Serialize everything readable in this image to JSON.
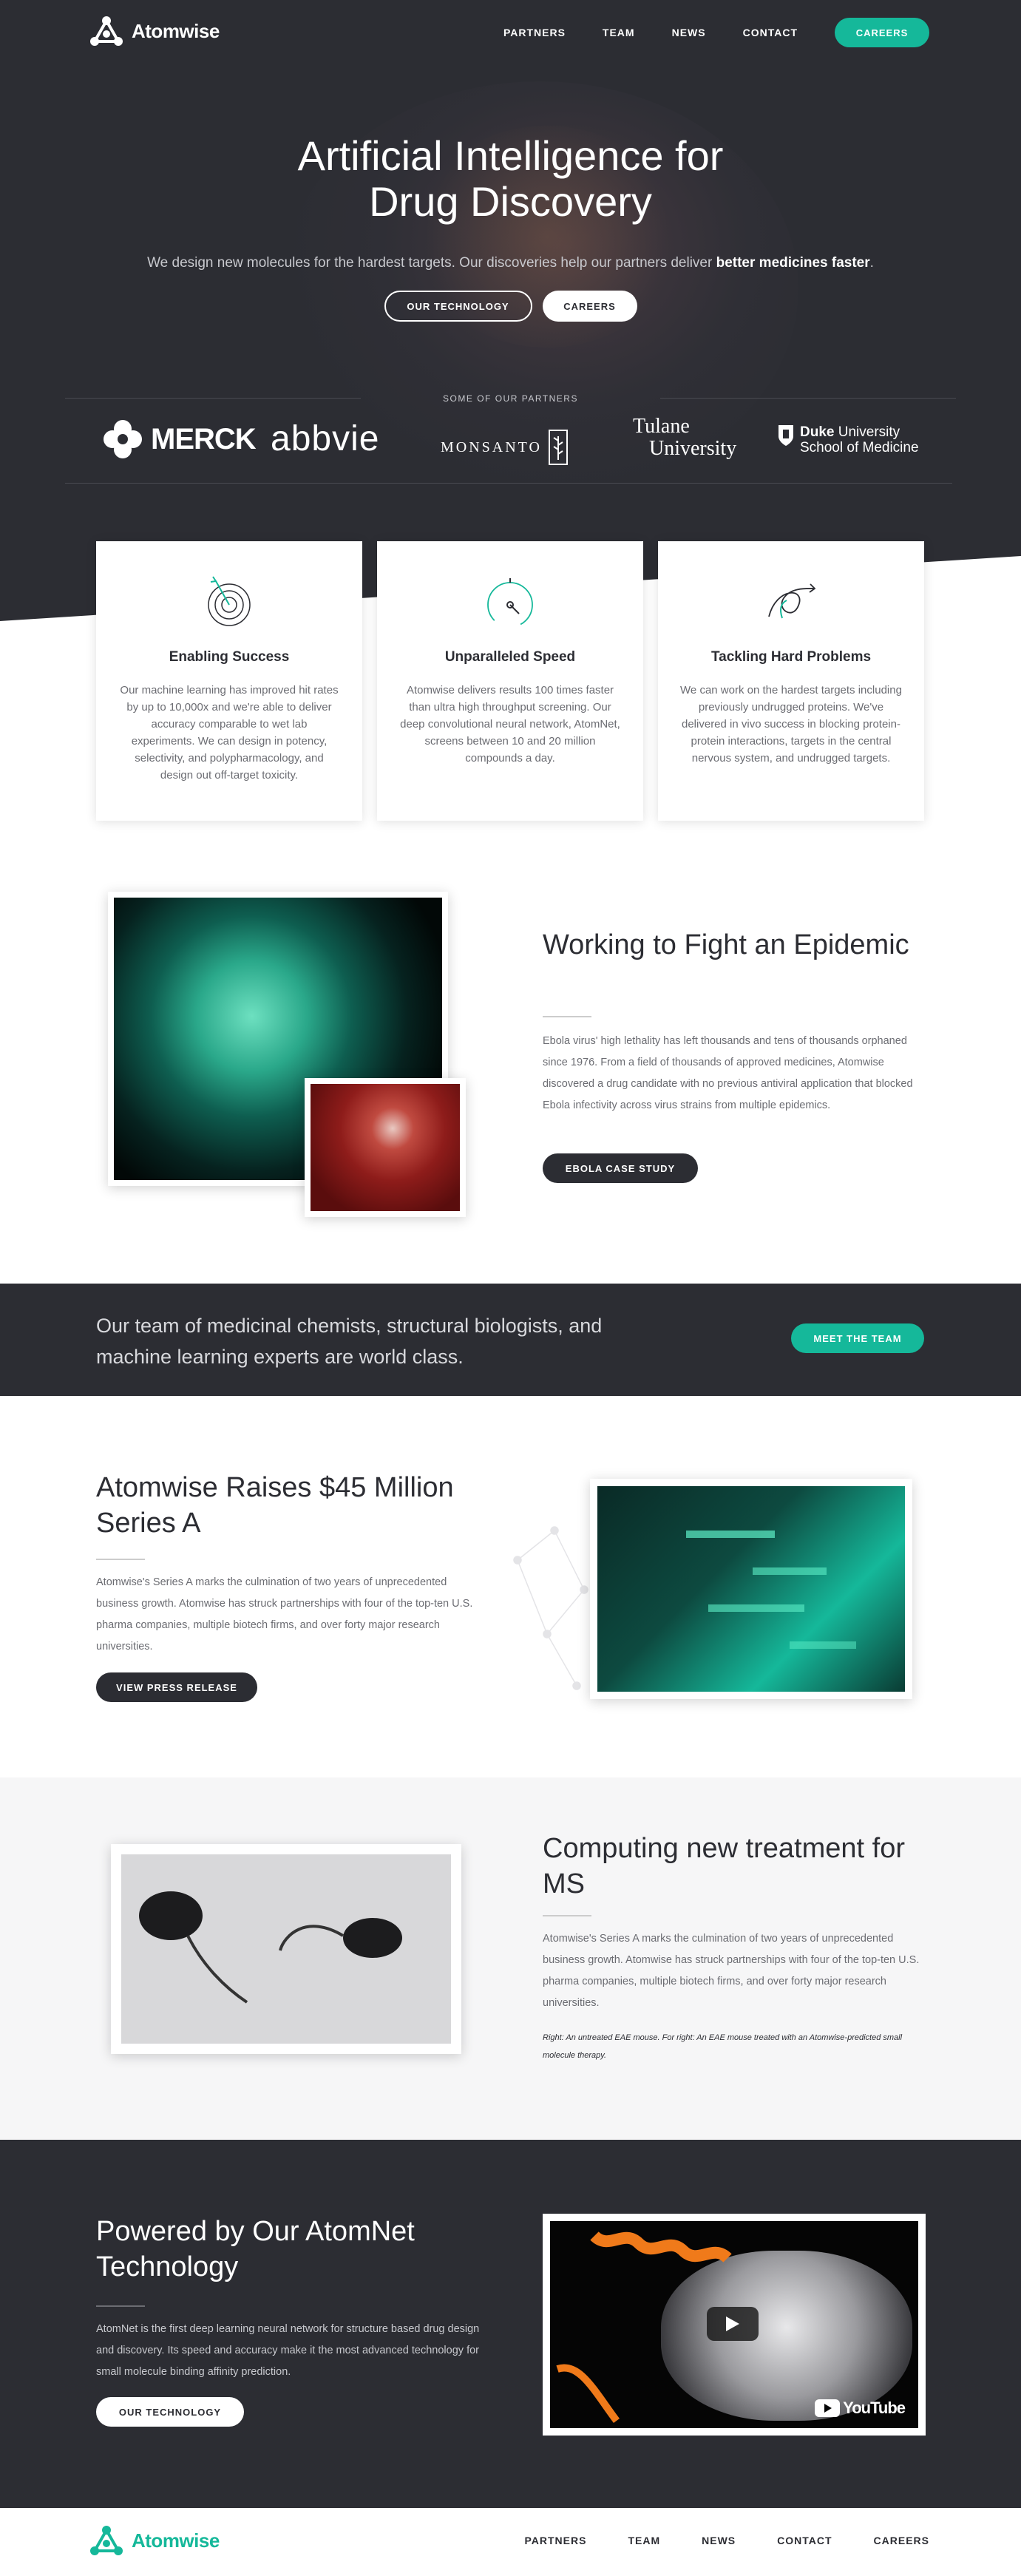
{
  "brand": {
    "name": "Atomwise",
    "teal": "#15b89a",
    "dark": "#2c2d33"
  },
  "nav": {
    "links": [
      "PARTNERS",
      "TEAM",
      "NEWS",
      "CONTACT"
    ],
    "cta": "CAREERS"
  },
  "hero": {
    "title_line1": "Artificial Intelligence for",
    "title_line2": "Drug Discovery",
    "subtitle": "We design new molecules for the hardest targets. Our discoveries help our partners deliver ",
    "subtitle_bold": "better medicines faster",
    "subtitle_end": ".",
    "btn_technology": "OUR TECHNOLOGY",
    "btn_careers": "CAREERS"
  },
  "partners": {
    "label": "SOME OF OUR PARTNERS",
    "merck": "MERCK",
    "abbvie": "abbvie",
    "monsanto": "MONSANTO",
    "tulane_line1": "Tulane",
    "tulane_line2": "University",
    "duke_bold": "Duke",
    "duke_line1_rest": " University",
    "duke_line2": "School of Medicine"
  },
  "features": [
    {
      "icon": "target-icon",
      "title": "Enabling Success",
      "text": "Our machine learning has improved hit rates by up to 10,000x and we're able to deliver accuracy comparable to wet lab experiments. We can design in potency, selectivity, and polypharmacology, and design out off-target toxicity."
    },
    {
      "icon": "speedometer-icon",
      "title": "Unparalleled Speed",
      "text": "Atomwise delivers results 100 times faster than ultra high throughput screening. Our deep convolutional neural network, AtomNet, screens between 10 and 20 million compounds a day."
    },
    {
      "icon": "tangled-arrow-icon",
      "title": "Tackling Hard Problems",
      "text": "We can work on the hardest targets including previously undrugged proteins. We've delivered in vivo success in blocking protein-protein interactions, targets in the central nervous system, and undrugged targets."
    }
  ],
  "epidemic": {
    "title": "Working to Fight an Epidemic",
    "text": "Ebola virus' high lethality has left thousands and tens of thousands orphaned since 1976. From a field of thousands of approved medicines, Atomwise discovered a drug candidate with no previous antiviral application that blocked Ebola infectivity across virus strains from multiple epidemics.",
    "button": "EBOLA CASE STUDY"
  },
  "team": {
    "text": "Our team of medicinal chemists, structural biologists, and machine learning experts are world class.",
    "button": "MEET THE TEAM"
  },
  "series_a": {
    "title": "Atomwise Raises $45 Million Series A",
    "text": "Atomwise's Series A marks the culmination of two years of unprecedented business growth. Atomwise has struck partnerships with four of the top-ten U.S. pharma companies, multiple biotech firms, and over forty major research universities.",
    "button": "VIEW PRESS RELEASE"
  },
  "ms": {
    "title": "Computing new treatment for MS",
    "text": "Atomwise's Series A marks the culmination of two years of unprecedented business growth. Atomwise has struck partnerships with four of the top-ten U.S. pharma companies, multiple biotech firms, and over forty major research universities.",
    "caption": "Right: An untreated EAE mouse. For right: An EAE mouse treated with an Atomwise-predicted small molecule therapy."
  },
  "atomnet": {
    "title": "Powered by Our AtomNet Technology",
    "text": "AtomNet is the first deep learning neural network for structure based drug design and discovery. Its speed and accuracy make it the most advanced technology for small molecule binding affinity prediction.",
    "button": "OUR TECHNOLOGY",
    "video_brand": "YouTube"
  },
  "footer": {
    "links": [
      "PARTNERS",
      "TEAM",
      "NEWS",
      "CONTACT",
      "CAREERS"
    ]
  }
}
